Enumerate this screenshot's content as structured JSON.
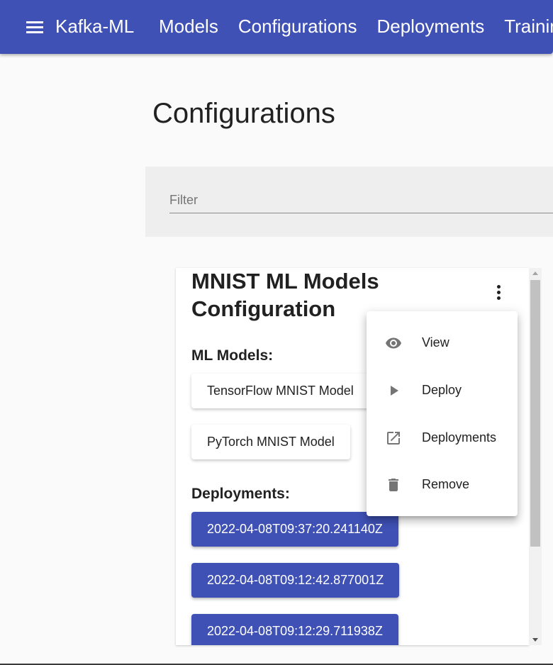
{
  "toolbar": {
    "brand": "Kafka-ML",
    "nav": [
      "Models",
      "Configurations",
      "Deployments",
      "Training Results"
    ]
  },
  "icons": {
    "menu": "menu-icon",
    "more": "more-vert-icon",
    "view": "eye-icon",
    "deploy": "play-icon",
    "deployments": "open-in-new-icon",
    "remove": "trash-icon"
  },
  "colors": {
    "primary": "#3f51b5",
    "icon_gray": "#757575"
  },
  "page": {
    "title": "Configurations"
  },
  "filter": {
    "placeholder": "Filter",
    "value": ""
  },
  "card": {
    "title": "MNIST ML Models Configuration",
    "models_label": "ML Models:",
    "models": [
      "TensorFlow MNIST Model",
      "PyTorch MNIST Model"
    ],
    "deployments_label": "Deployments:",
    "deployments": [
      "2022-04-08T09:37:20.241140Z",
      "2022-04-08T09:12:42.877001Z",
      "2022-04-08T09:12:29.711938Z"
    ]
  },
  "menu": {
    "items": [
      {
        "label": "View",
        "icon": "eye-icon"
      },
      {
        "label": "Deploy",
        "icon": "play-icon"
      },
      {
        "label": "Deployments",
        "icon": "open-in-new-icon"
      },
      {
        "label": "Remove",
        "icon": "trash-icon"
      }
    ]
  }
}
